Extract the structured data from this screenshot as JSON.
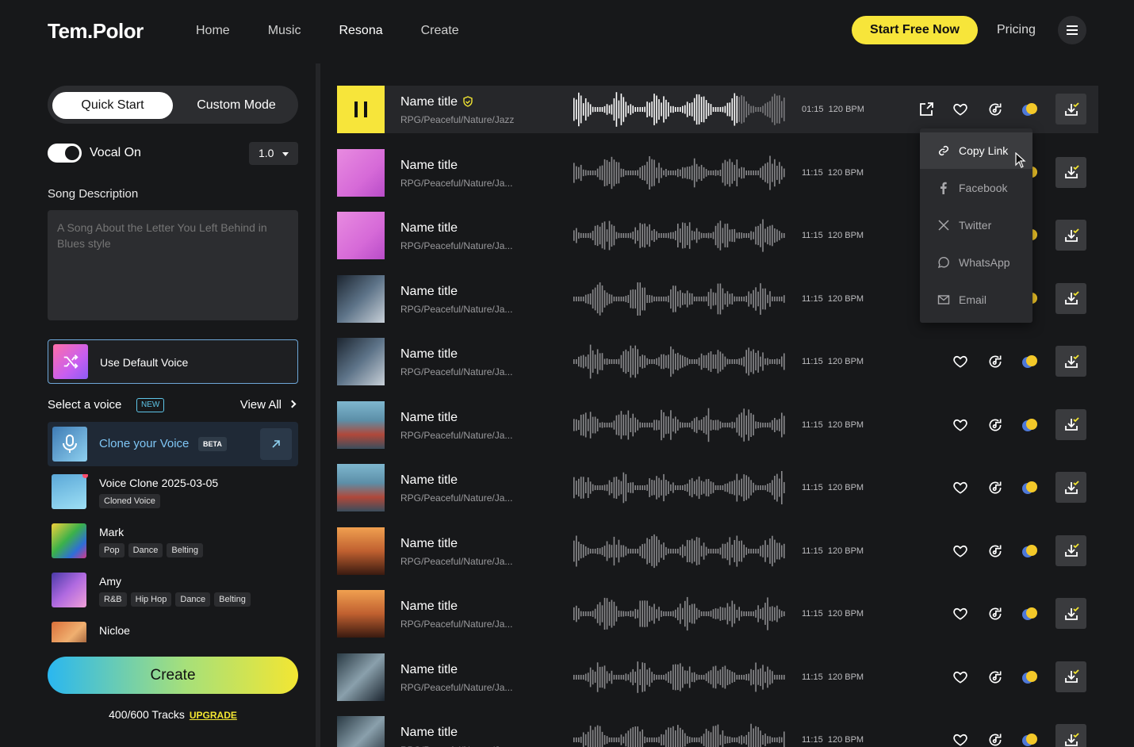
{
  "header": {
    "logo": "Tem.Polor",
    "nav": [
      "Home",
      "Music",
      "Resona",
      "Create"
    ],
    "active_nav": "Resona",
    "start_button": "Start Free Now",
    "pricing": "Pricing"
  },
  "sidebar": {
    "mode_quick": "Quick Start",
    "mode_custom": "Custom Mode",
    "vocal_label": "Vocal On",
    "vocal_on": true,
    "version": "1.0",
    "song_desc_label": "Song Description",
    "song_desc_placeholder": "A Song About the Letter You Left Behind in Blues style",
    "default_voice": "Use Default Voice",
    "select_voice": "Select a voice",
    "new_badge": "NEW",
    "view_all": "View All",
    "clone_label": "Clone your Voice",
    "beta_badge": "BETA",
    "voices": [
      {
        "name": "Voice Clone 2025-03-05",
        "tags": [
          "Cloned Voice"
        ]
      },
      {
        "name": "Mark",
        "tags": [
          "Pop",
          "Dance",
          "Belting"
        ]
      },
      {
        "name": "Amy",
        "tags": [
          "R&B",
          "Hip Hop",
          "Dance",
          "Belting"
        ]
      },
      {
        "name": "Nicloe",
        "tags": []
      }
    ],
    "create_button": "Create",
    "tracks_used": "400/600 Tracks",
    "upgrade": "UPGRADE"
  },
  "tracks": [
    {
      "title": "Name title",
      "tags": "RPG/Peaceful/Nature/Jazz",
      "duration": "01:15",
      "bpm": "120 BPM"
    },
    {
      "title": "Name title",
      "tags": "RPG/Peaceful/Nature/Ja...",
      "duration": "11:15",
      "bpm": "120 BPM"
    },
    {
      "title": "Name title",
      "tags": "RPG/Peaceful/Nature/Ja...",
      "duration": "11:15",
      "bpm": "120 BPM"
    },
    {
      "title": "Name title",
      "tags": "RPG/Peaceful/Nature/Ja...",
      "duration": "11:15",
      "bpm": "120 BPM"
    },
    {
      "title": "Name title",
      "tags": "RPG/Peaceful/Nature/Ja...",
      "duration": "11:15",
      "bpm": "120 BPM"
    },
    {
      "title": "Name title",
      "tags": "RPG/Peaceful/Nature/Ja...",
      "duration": "11:15",
      "bpm": "120 BPM"
    },
    {
      "title": "Name title",
      "tags": "RPG/Peaceful/Nature/Ja...",
      "duration": "11:15",
      "bpm": "120 BPM"
    },
    {
      "title": "Name title",
      "tags": "RPG/Peaceful/Nature/Ja...",
      "duration": "11:15",
      "bpm": "120 BPM"
    },
    {
      "title": "Name title",
      "tags": "RPG/Peaceful/Nature/Ja...",
      "duration": "11:15",
      "bpm": "120 BPM"
    },
    {
      "title": "Name title",
      "tags": "RPG/Peaceful/Nature/Ja...",
      "duration": "11:15",
      "bpm": "120 BPM"
    },
    {
      "title": "Name title",
      "tags": "RPG/Peaceful/Nature/Ja...",
      "duration": "11:15",
      "bpm": "120 BPM"
    }
  ],
  "share_menu": [
    "Copy Link",
    "Facebook",
    "Twitter",
    "WhatsApp",
    "Email"
  ],
  "colors": {
    "accent": "#f7e53a",
    "background": "#17181a",
    "panel": "#2c2d30",
    "clone_blue": "#7fc6f5"
  }
}
